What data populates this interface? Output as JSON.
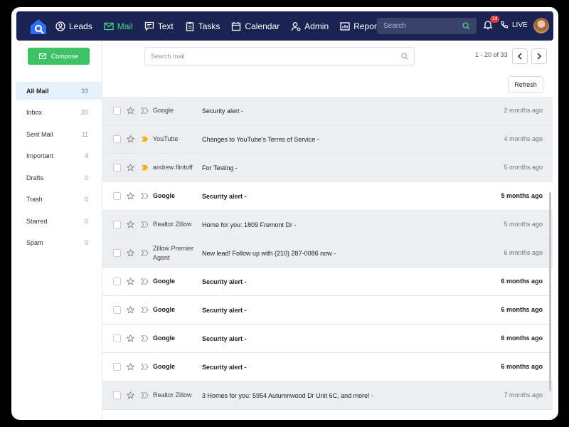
{
  "nav": {
    "items": [
      {
        "label": "Leads",
        "icon": "user-circle-icon"
      },
      {
        "label": "Mail",
        "icon": "mail-icon",
        "active": true
      },
      {
        "label": "Text",
        "icon": "chat-icon"
      },
      {
        "label": "Tasks",
        "icon": "clipboard-icon"
      },
      {
        "label": "Calendar",
        "icon": "calendar-icon"
      },
      {
        "label": "Admin",
        "icon": "user-gear-icon"
      },
      {
        "label": "Reporting",
        "icon": "chart-icon"
      }
    ],
    "search_placeholder": "Search",
    "notification_count": "14",
    "live_label": "LIVE",
    "active_color": "#4dd38a",
    "bg_color": "#1a2352"
  },
  "sidebar": {
    "compose_label": "Compose",
    "folders": [
      {
        "label": "All Mail",
        "count": "33"
      },
      {
        "label": "Inbox",
        "count": "20"
      },
      {
        "label": "Sent Mail",
        "count": "11"
      },
      {
        "label": "Important",
        "count": "4"
      },
      {
        "label": "Drafts",
        "count": "0"
      },
      {
        "label": "Trash",
        "count": "0"
      },
      {
        "label": "Starred",
        "count": "0"
      },
      {
        "label": "Spam",
        "count": "0"
      }
    ]
  },
  "main": {
    "search_placeholder": "Search mail",
    "pager": "1 - 20 of 33",
    "refresh_label": "Refresh",
    "emails": [
      {
        "sender": "Google",
        "subject": "Security alert -",
        "when": "2 months ago",
        "read": true,
        "important": false
      },
      {
        "sender": "YouTube",
        "subject": "Changes to YouTube's Terms of Service -",
        "when": "4 months ago",
        "read": true,
        "important": true
      },
      {
        "sender": "andrew flintoff",
        "subject": "For Testing -",
        "when": "5 months ago",
        "read": true,
        "important": true
      },
      {
        "sender": "Google",
        "subject": "Security alert -",
        "when": "5 months ago",
        "read": false,
        "important": false
      },
      {
        "sender": "Realtor Zillow",
        "subject": "Home for you: 1809 Fremont Dr -",
        "when": "5 months ago",
        "read": true,
        "important": false
      },
      {
        "sender": "Zillow Premier Agent",
        "subject": "New lead! Follow up with (210) 287-0086 now -",
        "when": "6 months ago",
        "read": true,
        "important": false
      },
      {
        "sender": "Google",
        "subject": "Security alert -",
        "when": "6 months ago",
        "read": false,
        "important": false
      },
      {
        "sender": "Google",
        "subject": "Security alert -",
        "when": "6 months ago",
        "read": false,
        "important": false
      },
      {
        "sender": "Google",
        "subject": "Security alert -",
        "when": "6 months ago",
        "read": false,
        "important": false
      },
      {
        "sender": "Google",
        "subject": "Security alert -",
        "when": "6 months ago",
        "read": false,
        "important": false
      },
      {
        "sender": "Realtor Zillow",
        "subject": "3 Homes for you: 5954 Autumnwood Dr Unit 6C, and more! -",
        "when": "7 months ago",
        "read": true,
        "important": false
      }
    ]
  }
}
